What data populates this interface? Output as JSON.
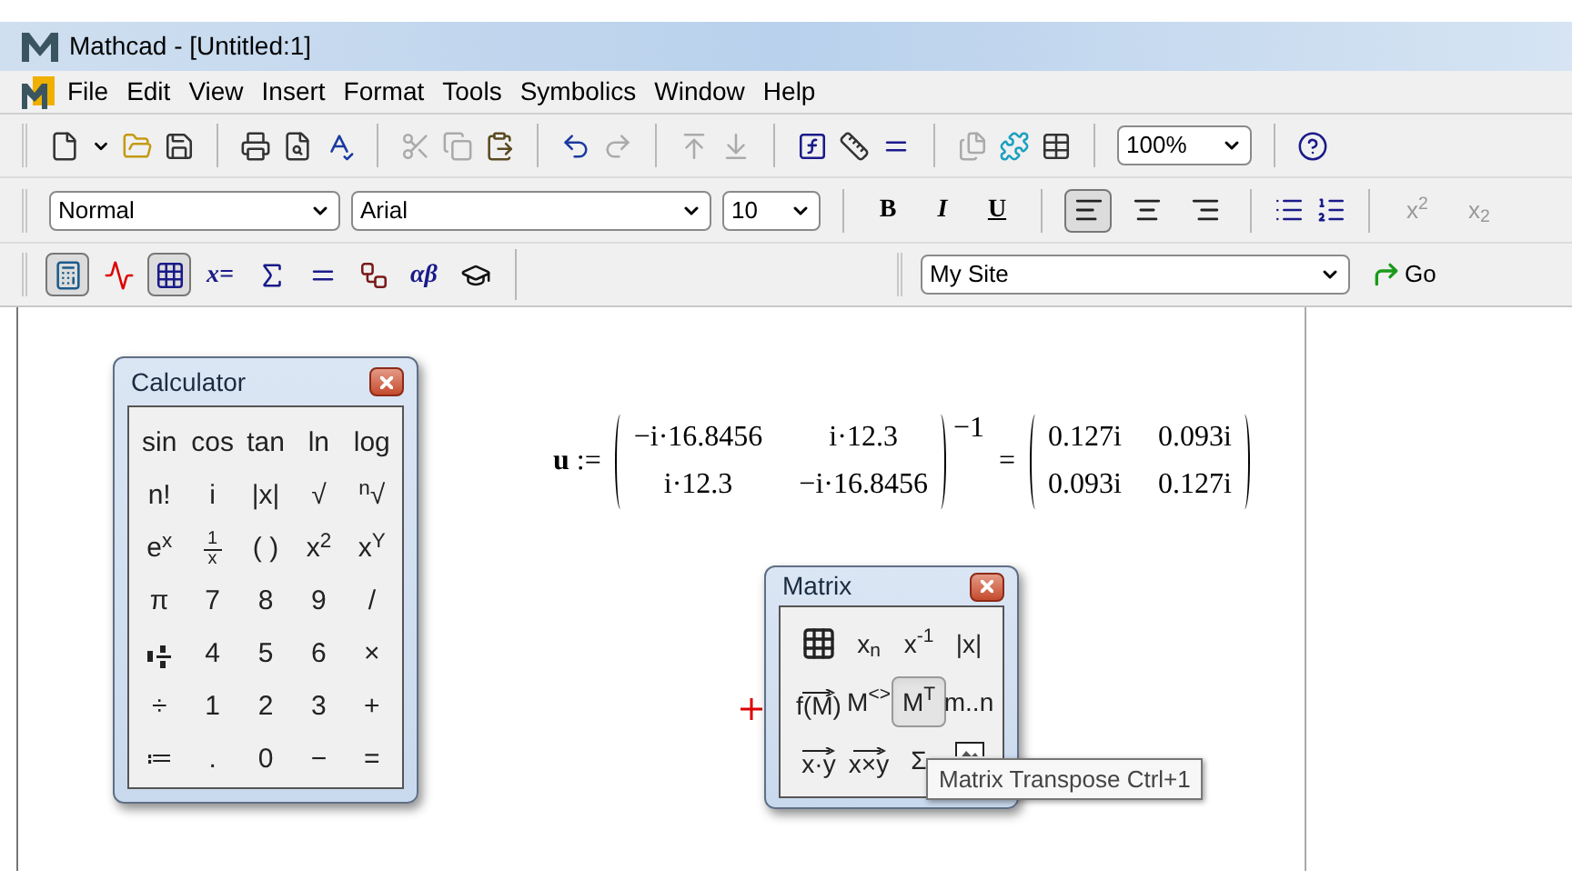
{
  "window": {
    "title": "Mathcad - [Untitled:1]"
  },
  "menu": [
    {
      "label": "File"
    },
    {
      "label": "Edit"
    },
    {
      "label": "View"
    },
    {
      "label": "Insert"
    },
    {
      "label": "Format"
    },
    {
      "label": "Tools"
    },
    {
      "label": "Symbolics"
    },
    {
      "label": "Window"
    },
    {
      "label": "Help"
    }
  ],
  "standard_toolbar": {
    "zoom": "100%"
  },
  "formatting_toolbar": {
    "style": "Normal",
    "font": "Arial",
    "size": "10",
    "bold": "B",
    "italic": "I",
    "underline": "U",
    "align": [
      {
        "selected": true
      },
      {
        "selected": false
      },
      {
        "selected": false
      }
    ],
    "superscript": "x$^{2}$",
    "subscript": "x$_{2}$"
  },
  "math_toolbar": [
    {
      "kind": "calculator",
      "selected": true
    },
    {
      "kind": "graph",
      "selected": false
    },
    {
      "kind": "matrix",
      "selected": true
    },
    {
      "kind": "text",
      "label": "x=",
      "selected": false
    },
    {
      "kind": "calculus",
      "selected": false
    },
    {
      "kind": "boolean",
      "selected": false
    },
    {
      "kind": "programming",
      "selected": false
    },
    {
      "kind": "text",
      "label": "αβ",
      "selected": false
    },
    {
      "kind": "symbolic",
      "selected": false
    }
  ],
  "resources_toolbar": {
    "site": "My Site",
    "go": "Go"
  },
  "equation": {
    "variable": "u",
    "assign": ":=",
    "matrix": [
      [
        "−i·16.8456",
        "i·12.3"
      ],
      [
        "i·12.3",
        "−i·16.8456"
      ]
    ],
    "exponent": "−1",
    "equals": "=",
    "result": [
      [
        "0.127i",
        "0.093i"
      ],
      [
        "0.093i",
        "0.127i"
      ]
    ]
  },
  "calculator": {
    "title": "Calculator",
    "keys": [
      [
        {
          "kind": "text",
          "label": "sin"
        },
        {
          "kind": "text",
          "label": "cos"
        },
        {
          "kind": "text",
          "label": "tan"
        },
        {
          "kind": "text",
          "label": "ln"
        },
        {
          "kind": "text",
          "label": "log"
        }
      ],
      [
        {
          "kind": "text",
          "label": "n!"
        },
        {
          "kind": "text",
          "label": "i"
        },
        {
          "kind": "text",
          "label": "|x|"
        },
        {
          "kind": "text",
          "label": "√"
        },
        {
          "kind": "text",
          "label": "$^{n}$√"
        }
      ],
      [
        {
          "kind": "text",
          "label": "e$^{x}$"
        },
        {
          "kind": "fraction",
          "num": "1",
          "den": "x"
        },
        {
          "kind": "text",
          "label": "( )"
        },
        {
          "kind": "text",
          "label": "x$^{2}$"
        },
        {
          "kind": "text",
          "label": "x$^{Y}$"
        }
      ],
      [
        {
          "kind": "text",
          "label": "π"
        },
        {
          "kind": "text",
          "label": "7"
        },
        {
          "kind": "text",
          "label": "8"
        },
        {
          "kind": "text",
          "label": "9"
        },
        {
          "kind": "text",
          "label": "/"
        }
      ],
      [
        {
          "kind": "mixed"
        },
        {
          "kind": "text",
          "label": "4"
        },
        {
          "kind": "text",
          "label": "5"
        },
        {
          "kind": "text",
          "label": "6"
        },
        {
          "kind": "text",
          "label": "×"
        }
      ],
      [
        {
          "kind": "text",
          "label": "÷"
        },
        {
          "kind": "text",
          "label": "1"
        },
        {
          "kind": "text",
          "label": "2"
        },
        {
          "kind": "text",
          "label": "3"
        },
        {
          "kind": "text",
          "label": "+"
        }
      ],
      [
        {
          "kind": "text",
          "label": "≔"
        },
        {
          "kind": "text",
          "label": "."
        },
        {
          "kind": "text",
          "label": "0"
        },
        {
          "kind": "text",
          "label": "−"
        },
        {
          "kind": "text",
          "label": "="
        }
      ]
    ]
  },
  "matrix_palette": {
    "title": "Matrix",
    "buttons": [
      [
        {
          "kind": "grid",
          "selected": false
        },
        {
          "kind": "text",
          "label": "x$_{n}$",
          "selected": false
        },
        {
          "kind": "text",
          "label": "x$^{-1}$",
          "selected": false
        },
        {
          "kind": "text",
          "label": "|x|",
          "selected": false
        }
      ],
      [
        {
          "kind": "vector",
          "label": "f(M)",
          "selected": false
        },
        {
          "kind": "text",
          "label": "M$^{<>}$",
          "selected": false
        },
        {
          "kind": "text",
          "label": "M$^{T}$",
          "selected": true
        },
        {
          "kind": "text",
          "label": "m..n",
          "selected": false
        }
      ],
      [
        {
          "kind": "vector",
          "label": "x·y",
          "selected": false
        },
        {
          "kind": "vector",
          "label": "x×y",
          "selected": false
        },
        {
          "kind": "text",
          "label": "Σ",
          "selected": false
        },
        {
          "kind": "picture",
          "selected": false
        }
      ]
    ]
  },
  "tooltip": "Matrix Transpose Ctrl+1"
}
